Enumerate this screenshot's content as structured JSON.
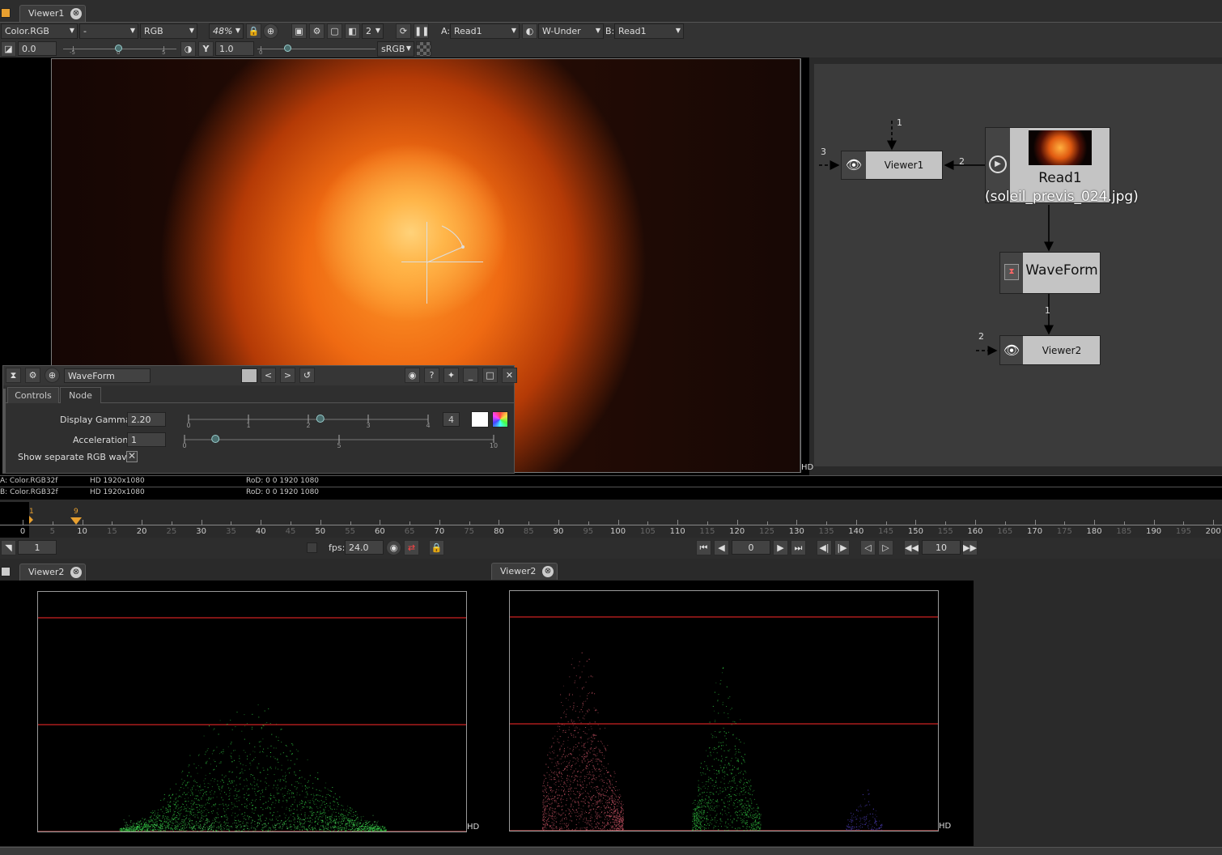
{
  "viewer1": {
    "tab": "Viewer1",
    "close_glyph": "⊗",
    "layer": "Color.RGB",
    "alpha": "-",
    "channels": "RGB",
    "zoom": "48%",
    "proxy": "2",
    "a_label": "A:",
    "a_input": "Read1",
    "composite": "W-Under",
    "b_label": "B:",
    "b_input": "Read1",
    "gain": "0.0",
    "gain_ticks": [
      "-5",
      "0",
      "5"
    ],
    "gamma": "1.0",
    "gamma_ticks": [
      "0"
    ],
    "colorspace": "sRGB",
    "hd": "HD"
  },
  "info": {
    "a_line": "A: Color.RGB32f",
    "a_format": "HD 1920x1080",
    "a_rod": "RoD: 0 0 1920 1080",
    "b_line": "B: Color.RGB32f",
    "b_format": "HD 1920x1080",
    "b_rod": "RoD: 0 0 1920 1080"
  },
  "nodegraph": {
    "viewer1": "Viewer1",
    "read1": "Read1",
    "read1_file": "(soleil_previs_024.jpg)",
    "waveform": "WaveForm",
    "viewer2": "Viewer2",
    "input_labels": {
      "v1_top": "1",
      "v1_left": "3",
      "v1_right": "2",
      "wf_out": "1",
      "v2_left": "2"
    }
  },
  "panel": {
    "title": "WaveForm",
    "tabs": [
      "Controls",
      "Node"
    ],
    "display_gamma_label": "Display Gamma",
    "display_gamma": "2.20",
    "gamma_ticks": [
      "0",
      "1",
      "2",
      "3",
      "4"
    ],
    "gamma_slider": 2.2,
    "gamma_max": "4",
    "acceleration_label": "Acceleration",
    "acceleration": "1",
    "accel_ticks": [
      "0",
      "5",
      "10"
    ],
    "accel_slider": 1,
    "separate_rgb_label": "Show separate RGB waves"
  },
  "timeline": {
    "start_marker": "1",
    "current_marker": "9",
    "ticks": [
      "0",
      "5",
      "10",
      "15",
      "20",
      "25",
      "30",
      "35",
      "40",
      "45",
      "50",
      "55",
      "60",
      "65",
      "70",
      "75",
      "80",
      "85",
      "90",
      "95",
      "100",
      "105",
      "110",
      "115",
      "120",
      "125",
      "130",
      "135",
      "140",
      "145",
      "150",
      "155",
      "160",
      "165",
      "170",
      "175",
      "180",
      "185",
      "190",
      "195",
      "200"
    ],
    "increment": "1",
    "fps_label": "fps:",
    "fps": "24.0",
    "frame": "0",
    "skip": "10"
  },
  "viewer2_left": {
    "tab": "Viewer2",
    "hd": "HD"
  },
  "viewer2_right": {
    "tab": "Viewer2",
    "hd": "HD"
  },
  "colors": {
    "accent": "#e8a030",
    "waveform_green": "#33cc44",
    "waveform_red": "#cc5566",
    "waveform_blue": "#5544cc",
    "guide_red": "#cc2222"
  }
}
